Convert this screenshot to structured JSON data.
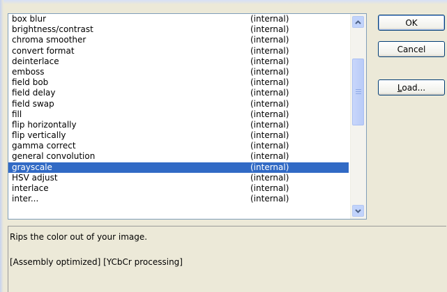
{
  "filters": [
    {
      "name": "box blur",
      "type": "(internal)"
    },
    {
      "name": "brightness/contrast",
      "type": "(internal)"
    },
    {
      "name": "chroma smoother",
      "type": "(internal)"
    },
    {
      "name": "convert format",
      "type": "(internal)"
    },
    {
      "name": "deinterlace",
      "type": "(internal)"
    },
    {
      "name": "emboss",
      "type": "(internal)"
    },
    {
      "name": "field bob",
      "type": "(internal)"
    },
    {
      "name": "field delay",
      "type": "(internal)"
    },
    {
      "name": "field swap",
      "type": "(internal)"
    },
    {
      "name": "fill",
      "type": "(internal)"
    },
    {
      "name": "flip horizontally",
      "type": "(internal)"
    },
    {
      "name": "flip vertically",
      "type": "(internal)"
    },
    {
      "name": "gamma correct",
      "type": "(internal)"
    },
    {
      "name": "general convolution",
      "type": "(internal)"
    },
    {
      "name": "grayscale",
      "type": "(internal)",
      "selected": true
    },
    {
      "name": "HSV adjust",
      "type": "(internal)"
    },
    {
      "name": "interlace",
      "type": "(internal)"
    },
    {
      "name": "inter...",
      "type": "(internal)"
    }
  ],
  "description": {
    "line1": "Rips the color out of your image.",
    "line2": "[Assembly optimized] [YCbCr processing]"
  },
  "buttons": {
    "ok": "OK",
    "cancel": "Cancel",
    "load_accel": "L",
    "load_rest": "oad..."
  },
  "colors": {
    "selection": "#316ac5",
    "dialog_bg": "#ece9d8"
  }
}
